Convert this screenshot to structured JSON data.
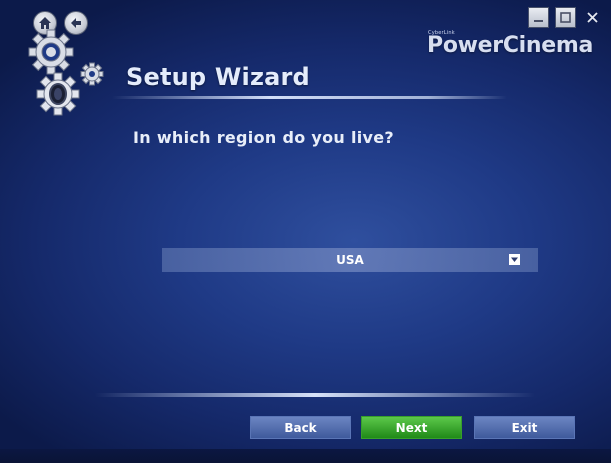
{
  "app": {
    "brand_small": "CyberLink",
    "brand_name": "PowerCinema"
  },
  "wizard": {
    "title": "Setup Wizard",
    "question": "In which region do you live?",
    "region_selected": "USA"
  },
  "buttons": {
    "back": "Back",
    "next": "Next",
    "exit": "Exit"
  },
  "icons": {
    "top_left": [
      "home-icon",
      "back-arrow-icon"
    ],
    "window": [
      "minimize-icon",
      "maximize-icon",
      "close-icon"
    ],
    "dropdown": "chevron-down-icon",
    "decor": "gears-icon"
  },
  "colors": {
    "background": "#1f3a86",
    "next_button": "#2fa523",
    "nav_button": "#5670b0"
  }
}
